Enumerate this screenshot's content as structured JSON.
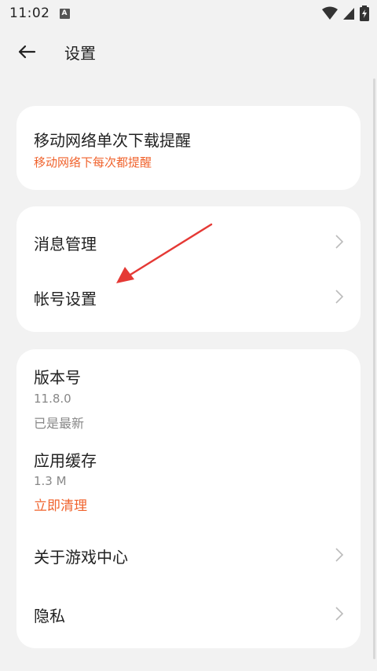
{
  "status": {
    "time": "11:02",
    "badge": "A"
  },
  "header": {
    "title": "设置"
  },
  "card1": {
    "title": "移动网络单次下载提醒",
    "subtitle": "移动网络下每次都提醒"
  },
  "card2": {
    "items": [
      {
        "label": "消息管理"
      },
      {
        "label": "帐号设置"
      }
    ]
  },
  "card3": {
    "version": {
      "title": "版本号",
      "value": "11.8.0",
      "status": "已是最新"
    },
    "cache": {
      "title": "应用缓存",
      "size": "1.3 M",
      "action": "立即清理"
    },
    "items": [
      {
        "label": "关于游戏中心"
      },
      {
        "label": "隐私"
      }
    ]
  },
  "colors": {
    "accent": "#f0632d",
    "annotation": "#e53935",
    "background": "#f2f2f2"
  }
}
